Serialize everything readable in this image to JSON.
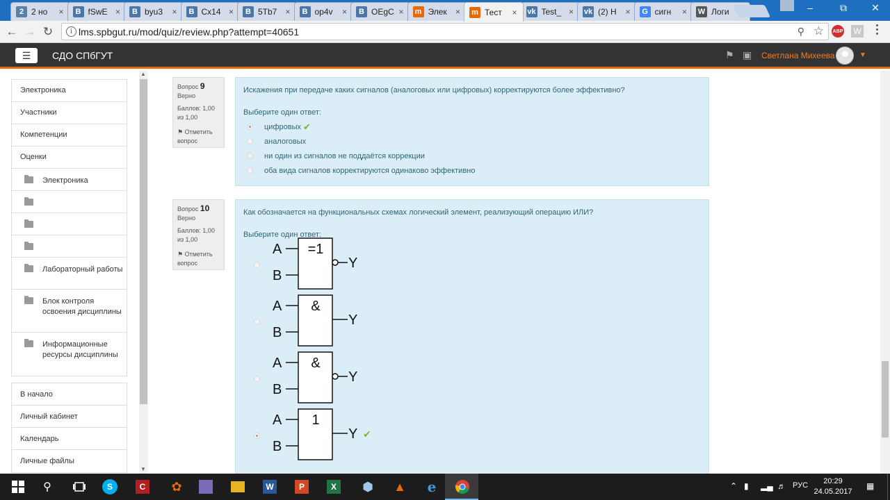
{
  "browser": {
    "tabs": [
      {
        "favicon": "2",
        "favicon_color": "#5a7fa8",
        "title": "2 но"
      },
      {
        "favicon": "B",
        "favicon_color": "#4a76a8",
        "title": "fSwE"
      },
      {
        "favicon": "B",
        "favicon_color": "#4a76a8",
        "title": "byu3"
      },
      {
        "favicon": "B",
        "favicon_color": "#4a76a8",
        "title": "Cx14"
      },
      {
        "favicon": "B",
        "favicon_color": "#4a76a8",
        "title": "5Tb7"
      },
      {
        "favicon": "B",
        "favicon_color": "#4a76a8",
        "title": "op4v"
      },
      {
        "favicon": "B",
        "favicon_color": "#4a76a8",
        "title": "OEgC"
      },
      {
        "favicon": "m",
        "favicon_color": "#e8690a",
        "title": "Элек"
      },
      {
        "favicon": "m",
        "favicon_color": "#e8690a",
        "title": "Тест"
      },
      {
        "favicon": "vk",
        "favicon_color": "#4a76a8",
        "title": "Test_"
      },
      {
        "favicon": "vk",
        "favicon_color": "#4a76a8",
        "title": "(2) Н"
      },
      {
        "favicon": "G",
        "favicon_color": "#4285f4",
        "title": "сигн"
      },
      {
        "favicon": "W",
        "favicon_color": "#555555",
        "title": "Логи"
      }
    ],
    "active_tab_index": 8,
    "url": "lms.spbgut.ru/mod/quiz/review.php?attempt=40651",
    "ext_abp": "ABP",
    "ext_w": "W"
  },
  "site": {
    "brand": "СДО СПбГУТ",
    "username": "Светлана Михеева",
    "accent_color": "#e8690a"
  },
  "sidebar": {
    "nav": [
      {
        "label": "Электроника",
        "sub": false
      },
      {
        "label": "Участники",
        "sub": false
      },
      {
        "label": "Компетенции",
        "sub": false
      },
      {
        "label": "Оценки",
        "sub": false
      },
      {
        "label": "Электроника",
        "sub": true
      },
      {
        "label": "",
        "sub": true
      },
      {
        "label": "",
        "sub": true
      },
      {
        "label": "",
        "sub": true
      },
      {
        "label": "Лабораторный работы",
        "sub": true
      },
      {
        "label": "Блок контроля освоения дисциплины",
        "sub": true
      },
      {
        "label": "Информационные ресурсы дисциплины",
        "sub": true
      }
    ],
    "links": [
      {
        "label": "В начало"
      },
      {
        "label": "Личный кабинет"
      },
      {
        "label": "Календарь"
      },
      {
        "label": "Личные файлы"
      }
    ]
  },
  "questions": [
    {
      "label": "Вопрос",
      "number": "9",
      "state": "Верно",
      "grade": "Баллов: 1,00 из 1,00",
      "flag": "Отметить вопрос",
      "text": "Искажения при передаче каких сигналов (аналоговых или цифровых) корректируются более эффективно?",
      "prompt": "Выберите один ответ:",
      "options": [
        {
          "text": "цифровых",
          "selected": true,
          "correct": true
        },
        {
          "text": "аналоговых",
          "selected": false,
          "correct": false
        },
        {
          "text": "ни один из сигналов не поддаётся коррекции",
          "selected": false,
          "correct": false
        },
        {
          "text": "оба вида сигналов корректируются одинаково эффективно",
          "selected": false,
          "correct": false
        }
      ]
    },
    {
      "label": "Вопрос",
      "number": "10",
      "state": "Верно",
      "grade": "Баллов: 1,00 из 1,00",
      "flag": "Отметить вопрос",
      "text": "Как обозначается на функциональных схемах логический элемент, реализующий операцию ИЛИ?",
      "prompt": "Выберите один ответ:",
      "gate_inputs": [
        "A",
        "B"
      ],
      "gate_output": "Y",
      "gate_options": [
        {
          "symbol": "=1",
          "inverted": true,
          "selected": false,
          "correct": false
        },
        {
          "symbol": "&",
          "inverted": false,
          "selected": false,
          "correct": false
        },
        {
          "symbol": "&",
          "inverted": true,
          "selected": false,
          "correct": false
        },
        {
          "symbol": "1",
          "inverted": false,
          "selected": true,
          "correct": true
        }
      ]
    }
  ],
  "taskbar": {
    "lang": "РУС",
    "time": "20:29",
    "date": "24.05.2017"
  }
}
